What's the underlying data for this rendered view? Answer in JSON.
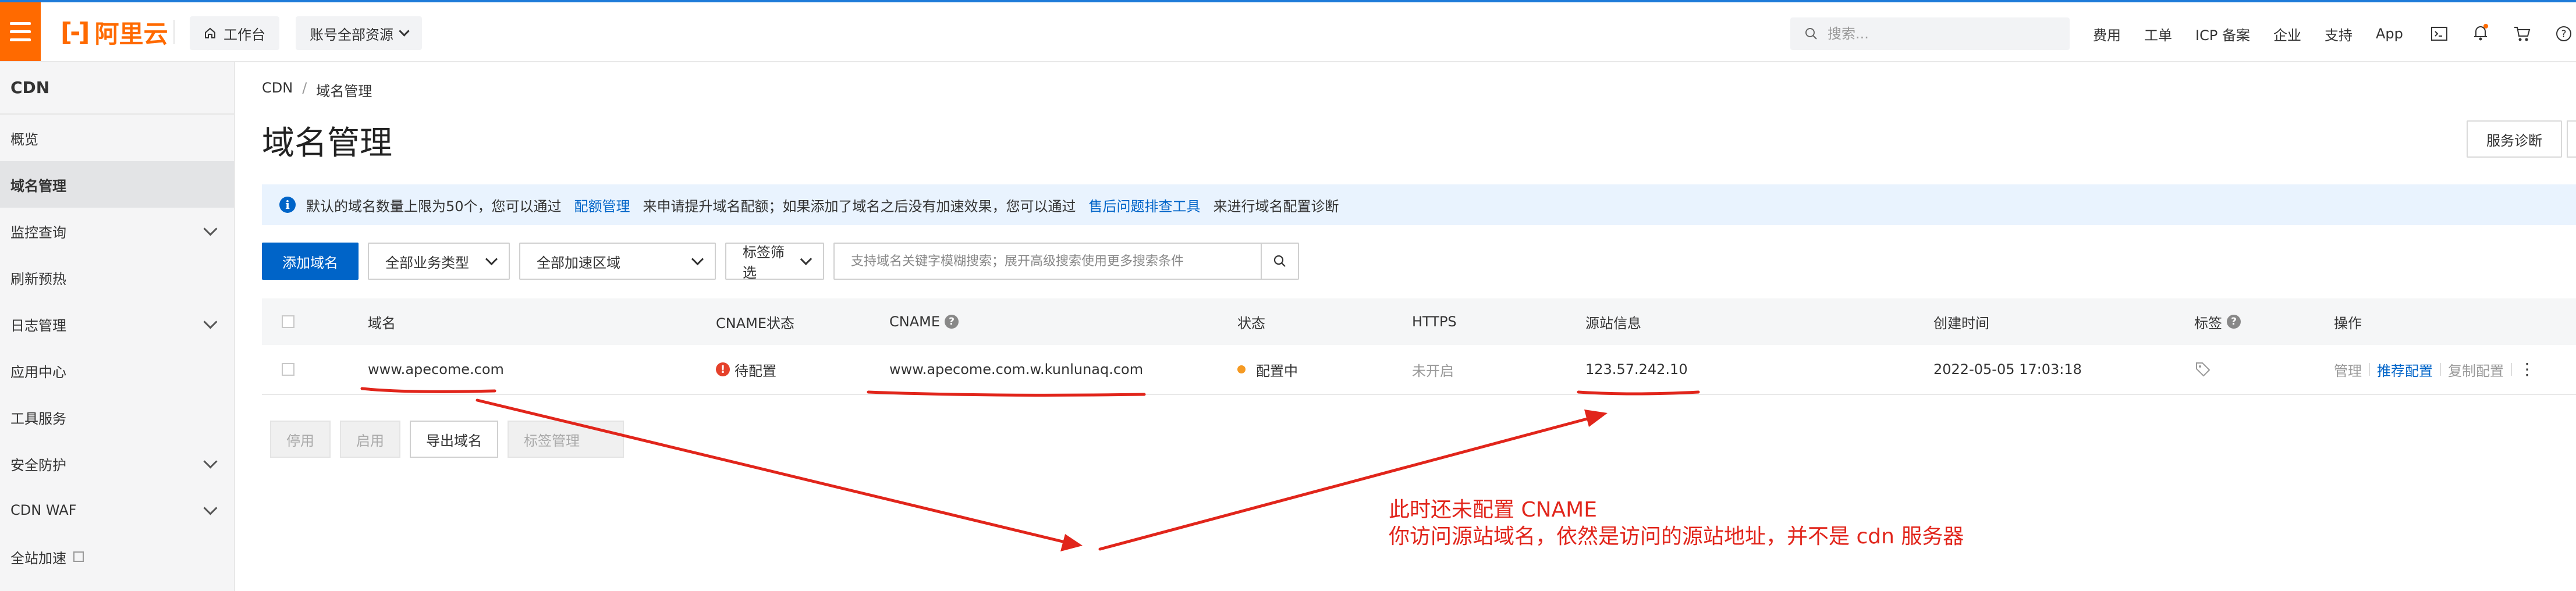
{
  "topbar": {
    "logo_text": "阿里云",
    "workbench": "工作台",
    "resources": "账号全部资源",
    "search_placeholder": "搜索...",
    "links": [
      "费用",
      "工单",
      "ICP 备案",
      "企业",
      "支持",
      "App"
    ],
    "brand_color": "#ff6a00"
  },
  "sidebar": {
    "title": "CDN",
    "items": [
      {
        "label": "概览"
      },
      {
        "label": "域名管理"
      },
      {
        "label": "监控查询"
      },
      {
        "label": "刷新预热"
      },
      {
        "label": "日志管理"
      },
      {
        "label": "应用中心"
      },
      {
        "label": "工具服务"
      },
      {
        "label": "安全防护"
      },
      {
        "label": "CDN WAF"
      },
      {
        "label": "全站加速"
      }
    ]
  },
  "breadcrumb": [
    "CDN",
    "域名管理"
  ],
  "page": {
    "title": "域名管理",
    "diagnose_button": "服务诊断"
  },
  "notice": {
    "text1": "默认的域名数量上限为50个，您可以通过",
    "link1": "配额管理",
    "text2": "来申请提升域名配额；如果添加了域名之后没有加速效果，您可以通过",
    "link2": "售后问题排查工具",
    "text3": "来进行域名配置诊断"
  },
  "toolbar": {
    "add_domain": "添加域名",
    "business_type": "全部业务类型",
    "region": "全部加速区域",
    "tag_filter": "标签筛选",
    "search_placeholder": "支持域名关键字模糊搜索；展开高级搜索使用更多搜索条件"
  },
  "table": {
    "headers": {
      "domain": "域名",
      "cname_status": "CNAME状态",
      "cname": "CNAME",
      "status": "状态",
      "https": "HTTPS",
      "origin": "源站信息",
      "created": "创建时间",
      "tag": "标签",
      "actions": "操作"
    },
    "rows": [
      {
        "domain": "www.apecome.com",
        "cname_status": "待配置",
        "cname": "www.apecome.com.w.kunlunaq.com",
        "status": "配置中",
        "https": "未开启",
        "origin": "123.57.242.10",
        "created": "2022-05-05 17:03:18",
        "actions": {
          "manage": "管理",
          "recommend": "推荐配置",
          "copy": "复制配置"
        }
      }
    ]
  },
  "bulk_actions": {
    "disable": "停用",
    "enable": "启用",
    "export": "导出域名",
    "tag_manage": "标签管理"
  },
  "annotation": {
    "line1": "此时还未配置 CNAME",
    "line2": "你访问源站域名，依然是访问的源站地址，并不是 cdn 服务器",
    "color": "#e1251b"
  }
}
